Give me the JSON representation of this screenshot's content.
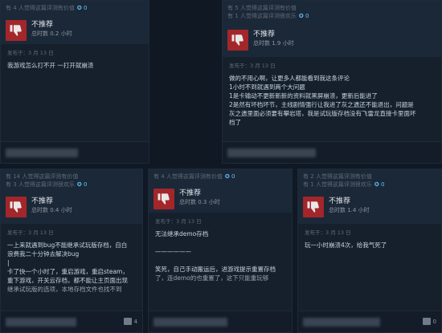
{
  "reviews": [
    {
      "helpful": "有 4 人觉得这篇评测有价值",
      "funny": "",
      "awards": "0",
      "verdict": "不推荐",
      "hours": "总时数 0.2 小时",
      "date": "发布于：3 月 13 日",
      "lines": [
        "我游戏怎么打不开 一打开就崩溃"
      ],
      "foot_count": ""
    },
    {
      "helpful": "有 5 人觉得这篇评测有价值",
      "funny": "有 1 人觉得这篇评测很欢乐",
      "awards": "0",
      "verdict": "不推荐",
      "hours": "总时数 1.9 小时",
      "date": "发布于：3 月 13 日",
      "lines": [
        "做的不用心啊，让更多人都能看到我这条评论",
        "1小时不到就遇到两个大问题",
        "1是卡输动不更新新新的资料就黑屏崩溃，更新后能进了",
        "2是然有坏档坏节，主线剧情强行让我进了灰之遗还不能退出，问题是",
        "灰之遗里面必须要有攀岩塔，我是试玩版存档没有飞雷龙直接卡里面坏",
        "档了"
      ],
      "foot_count": ""
    },
    {
      "helpful": "有 14 人觉得这篇评测有价值",
      "funny": "有 3 人觉得这篇评测很欢乐",
      "awards": "0",
      "verdict": "不推荐",
      "hours": "总时数 0.4 小时",
      "date": "发布于：3 月 13 日",
      "lines": [
        "一上来就遇到bug不能继承试玩版存档，自白",
        "浪费我二十分钟去解决bug",
        "|",
        "卡了快一个小时了，重启游戏，重启steam，",
        "重下游戏，开关云存档，都不能让主页面出现",
        "继承试玩版的选项，本地存档文件也找不到"
      ],
      "foot_count": "4"
    },
    {
      "helpful": "有 4 人觉得这篇评测有价值",
      "funny": "",
      "awards": "0",
      "verdict": "不推荐",
      "hours": "总时数 0.3 小时",
      "date": "发布于：3 月 13 日",
      "lines": [
        "无法继承demo存档",
        "",
        "——————",
        "",
        "笑死，自己手动搬运后，进游戏提示重置存档",
        "了，连demo的也重置了，这下只能重玩够"
      ],
      "foot_count": ""
    },
    {
      "helpful": "有 2 人觉得这篇评测有价值",
      "funny": "有 1 人觉得这篇评测很欢乐",
      "awards": "0",
      "verdict": "不推荐",
      "hours": "总时数 1.4 小时",
      "date": "发布于：3 月 13 日",
      "lines": [
        "玩一小时崩溃4次，给我气死了"
      ],
      "foot_count": "0"
    }
  ],
  "colors": {
    "thumb_down_bg": "#a3262a",
    "award_blue": "#66c0f4",
    "page_bg": "#0f1823"
  },
  "icons": {
    "verdict": "thumbs-down-icon",
    "award": "award-icon",
    "comment": "comment-icon"
  }
}
